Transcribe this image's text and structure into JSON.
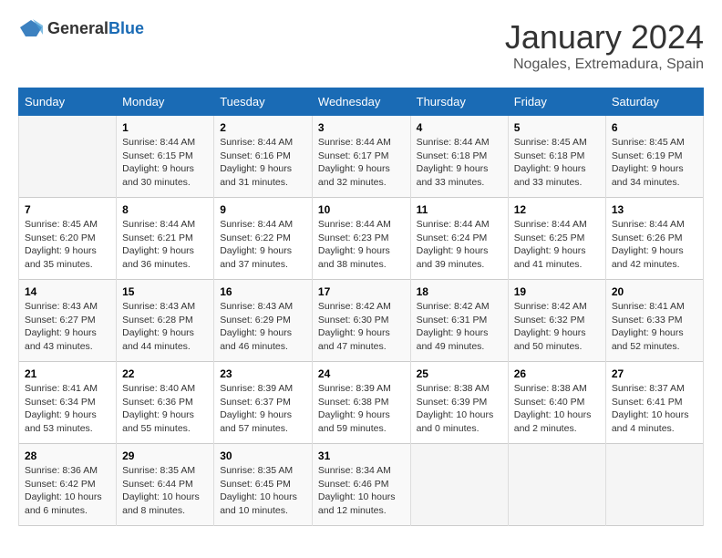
{
  "logo": {
    "text_general": "General",
    "text_blue": "Blue"
  },
  "title": "January 2024",
  "subtitle": "Nogales, Extremadura, Spain",
  "headers": [
    "Sunday",
    "Monday",
    "Tuesday",
    "Wednesday",
    "Thursday",
    "Friday",
    "Saturday"
  ],
  "weeks": [
    [
      {
        "day": "",
        "sunrise": "",
        "sunset": "",
        "daylight": ""
      },
      {
        "day": "1",
        "sunrise": "Sunrise: 8:44 AM",
        "sunset": "Sunset: 6:15 PM",
        "daylight": "Daylight: 9 hours and 30 minutes."
      },
      {
        "day": "2",
        "sunrise": "Sunrise: 8:44 AM",
        "sunset": "Sunset: 6:16 PM",
        "daylight": "Daylight: 9 hours and 31 minutes."
      },
      {
        "day": "3",
        "sunrise": "Sunrise: 8:44 AM",
        "sunset": "Sunset: 6:17 PM",
        "daylight": "Daylight: 9 hours and 32 minutes."
      },
      {
        "day": "4",
        "sunrise": "Sunrise: 8:44 AM",
        "sunset": "Sunset: 6:18 PM",
        "daylight": "Daylight: 9 hours and 33 minutes."
      },
      {
        "day": "5",
        "sunrise": "Sunrise: 8:45 AM",
        "sunset": "Sunset: 6:18 PM",
        "daylight": "Daylight: 9 hours and 33 minutes."
      },
      {
        "day": "6",
        "sunrise": "Sunrise: 8:45 AM",
        "sunset": "Sunset: 6:19 PM",
        "daylight": "Daylight: 9 hours and 34 minutes."
      }
    ],
    [
      {
        "day": "7",
        "sunrise": "Sunrise: 8:45 AM",
        "sunset": "Sunset: 6:20 PM",
        "daylight": "Daylight: 9 hours and 35 minutes."
      },
      {
        "day": "8",
        "sunrise": "Sunrise: 8:44 AM",
        "sunset": "Sunset: 6:21 PM",
        "daylight": "Daylight: 9 hours and 36 minutes."
      },
      {
        "day": "9",
        "sunrise": "Sunrise: 8:44 AM",
        "sunset": "Sunset: 6:22 PM",
        "daylight": "Daylight: 9 hours and 37 minutes."
      },
      {
        "day": "10",
        "sunrise": "Sunrise: 8:44 AM",
        "sunset": "Sunset: 6:23 PM",
        "daylight": "Daylight: 9 hours and 38 minutes."
      },
      {
        "day": "11",
        "sunrise": "Sunrise: 8:44 AM",
        "sunset": "Sunset: 6:24 PM",
        "daylight": "Daylight: 9 hours and 39 minutes."
      },
      {
        "day": "12",
        "sunrise": "Sunrise: 8:44 AM",
        "sunset": "Sunset: 6:25 PM",
        "daylight": "Daylight: 9 hours and 41 minutes."
      },
      {
        "day": "13",
        "sunrise": "Sunrise: 8:44 AM",
        "sunset": "Sunset: 6:26 PM",
        "daylight": "Daylight: 9 hours and 42 minutes."
      }
    ],
    [
      {
        "day": "14",
        "sunrise": "Sunrise: 8:43 AM",
        "sunset": "Sunset: 6:27 PM",
        "daylight": "Daylight: 9 hours and 43 minutes."
      },
      {
        "day": "15",
        "sunrise": "Sunrise: 8:43 AM",
        "sunset": "Sunset: 6:28 PM",
        "daylight": "Daylight: 9 hours and 44 minutes."
      },
      {
        "day": "16",
        "sunrise": "Sunrise: 8:43 AM",
        "sunset": "Sunset: 6:29 PM",
        "daylight": "Daylight: 9 hours and 46 minutes."
      },
      {
        "day": "17",
        "sunrise": "Sunrise: 8:42 AM",
        "sunset": "Sunset: 6:30 PM",
        "daylight": "Daylight: 9 hours and 47 minutes."
      },
      {
        "day": "18",
        "sunrise": "Sunrise: 8:42 AM",
        "sunset": "Sunset: 6:31 PM",
        "daylight": "Daylight: 9 hours and 49 minutes."
      },
      {
        "day": "19",
        "sunrise": "Sunrise: 8:42 AM",
        "sunset": "Sunset: 6:32 PM",
        "daylight": "Daylight: 9 hours and 50 minutes."
      },
      {
        "day": "20",
        "sunrise": "Sunrise: 8:41 AM",
        "sunset": "Sunset: 6:33 PM",
        "daylight": "Daylight: 9 hours and 52 minutes."
      }
    ],
    [
      {
        "day": "21",
        "sunrise": "Sunrise: 8:41 AM",
        "sunset": "Sunset: 6:34 PM",
        "daylight": "Daylight: 9 hours and 53 minutes."
      },
      {
        "day": "22",
        "sunrise": "Sunrise: 8:40 AM",
        "sunset": "Sunset: 6:36 PM",
        "daylight": "Daylight: 9 hours and 55 minutes."
      },
      {
        "day": "23",
        "sunrise": "Sunrise: 8:39 AM",
        "sunset": "Sunset: 6:37 PM",
        "daylight": "Daylight: 9 hours and 57 minutes."
      },
      {
        "day": "24",
        "sunrise": "Sunrise: 8:39 AM",
        "sunset": "Sunset: 6:38 PM",
        "daylight": "Daylight: 9 hours and 59 minutes."
      },
      {
        "day": "25",
        "sunrise": "Sunrise: 8:38 AM",
        "sunset": "Sunset: 6:39 PM",
        "daylight": "Daylight: 10 hours and 0 minutes."
      },
      {
        "day": "26",
        "sunrise": "Sunrise: 8:38 AM",
        "sunset": "Sunset: 6:40 PM",
        "daylight": "Daylight: 10 hours and 2 minutes."
      },
      {
        "day": "27",
        "sunrise": "Sunrise: 8:37 AM",
        "sunset": "Sunset: 6:41 PM",
        "daylight": "Daylight: 10 hours and 4 minutes."
      }
    ],
    [
      {
        "day": "28",
        "sunrise": "Sunrise: 8:36 AM",
        "sunset": "Sunset: 6:42 PM",
        "daylight": "Daylight: 10 hours and 6 minutes."
      },
      {
        "day": "29",
        "sunrise": "Sunrise: 8:35 AM",
        "sunset": "Sunset: 6:44 PM",
        "daylight": "Daylight: 10 hours and 8 minutes."
      },
      {
        "day": "30",
        "sunrise": "Sunrise: 8:35 AM",
        "sunset": "Sunset: 6:45 PM",
        "daylight": "Daylight: 10 hours and 10 minutes."
      },
      {
        "day": "31",
        "sunrise": "Sunrise: 8:34 AM",
        "sunset": "Sunset: 6:46 PM",
        "daylight": "Daylight: 10 hours and 12 minutes."
      },
      {
        "day": "",
        "sunrise": "",
        "sunset": "",
        "daylight": ""
      },
      {
        "day": "",
        "sunrise": "",
        "sunset": "",
        "daylight": ""
      },
      {
        "day": "",
        "sunrise": "",
        "sunset": "",
        "daylight": ""
      }
    ]
  ]
}
